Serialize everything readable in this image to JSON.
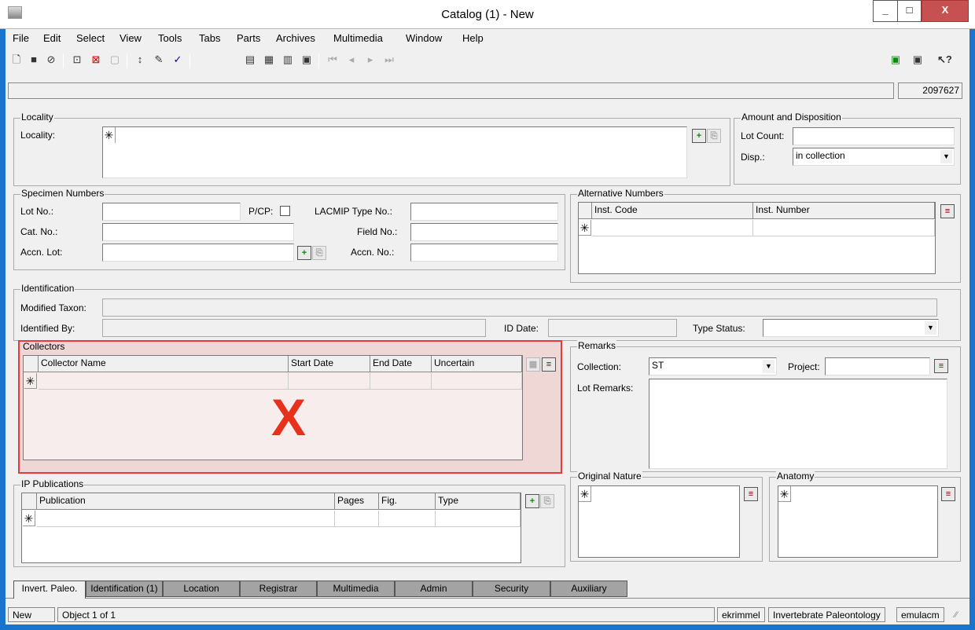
{
  "window": {
    "title": "Catalog (1) - New",
    "min": "_",
    "max": "□",
    "close": "X"
  },
  "menu": [
    "File",
    "Edit",
    "Select",
    "View",
    "Tools",
    "Tabs",
    "Parts",
    "Archives",
    "Multimedia",
    "Window",
    "Help"
  ],
  "record_id": "2097627",
  "locality": {
    "legend": "Locality",
    "label": "Locality:",
    "value": ""
  },
  "amount": {
    "legend": "Amount and Disposition",
    "lot_count_label": "Lot Count:",
    "lot_count": "",
    "disp_label": "Disp.:",
    "disp_value": "in collection"
  },
  "specimen": {
    "legend": "Specimen Numbers",
    "lot_no": "Lot No.:",
    "pcp": "P/CP:",
    "lacmip": "LACMIP Type No.:",
    "cat_no": "Cat. No.:",
    "field_no": "Field No.:",
    "accn_lot": "Accn. Lot:",
    "accn_no": "Accn. No.:"
  },
  "alt_numbers": {
    "legend": "Alternative Numbers",
    "columns": [
      "Inst. Code",
      "Inst. Number"
    ]
  },
  "identification": {
    "legend": "Identification",
    "modified_taxon": "Modified Taxon:",
    "identified_by": "Identified By:",
    "id_date": "ID Date:",
    "type_status": "Type Status:"
  },
  "collectors": {
    "legend": "Collectors",
    "columns": [
      "Collector Name",
      "Start Date",
      "End Date",
      "Uncertain"
    ],
    "overlay": "X"
  },
  "remarks": {
    "legend": "Remarks",
    "collection_label": "Collection:",
    "collection_value": "ST",
    "project_label": "Project:",
    "lot_remarks": "Lot Remarks:"
  },
  "ip_pubs": {
    "legend": "IP Publications",
    "columns": [
      "Publication",
      "Pages",
      "Fig.",
      "Type"
    ]
  },
  "original_nature": {
    "legend": "Original Nature"
  },
  "anatomy": {
    "legend": "Anatomy"
  },
  "tabs": [
    "Invert. Paleo.",
    "Identification (1)",
    "Location",
    "Registrar",
    "Multimedia",
    "Admin",
    "Security",
    "Auxiliary"
  ],
  "status": {
    "mode": "New",
    "object": "Object 1 of 1",
    "user": "ekrimmel",
    "dept": "Invertebrate Paleontology",
    "db": "emulacm"
  },
  "star": "✳"
}
